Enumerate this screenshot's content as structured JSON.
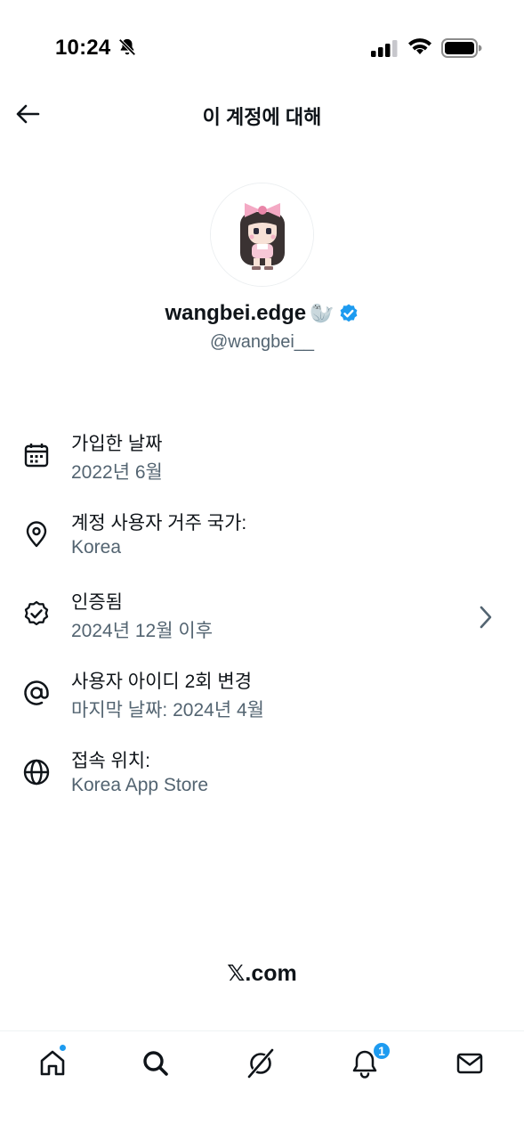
{
  "status_bar": {
    "time": "10:24"
  },
  "header": {
    "title": "이 계정에 대해"
  },
  "profile": {
    "display_name": "wangbei.edge",
    "name_emoji": "🦭",
    "handle": "@wangbei__",
    "verified_color": "#1d9bf0"
  },
  "info": [
    {
      "icon": "calendar-icon",
      "label": "가입한 날짜",
      "value": "2022년 6월"
    },
    {
      "icon": "location-pin-icon",
      "label": "계정 사용자 거주 국가:",
      "value": "Korea"
    },
    {
      "icon": "verified-badge-icon",
      "label": "인증됨",
      "value": "2024년 12월 이후"
    },
    {
      "icon": "at-sign-icon",
      "label": "사용자 아이디 2회 변경",
      "value": "마지막 날짜: 2024년 4월"
    },
    {
      "icon": "globe-icon",
      "label": "접속 위치:",
      "value": "Korea App Store"
    }
  ],
  "footer": {
    "brand": "𝕏.com"
  },
  "tab_bar": {
    "notifications_badge": "1",
    "accent_color": "#1d9bf0"
  }
}
